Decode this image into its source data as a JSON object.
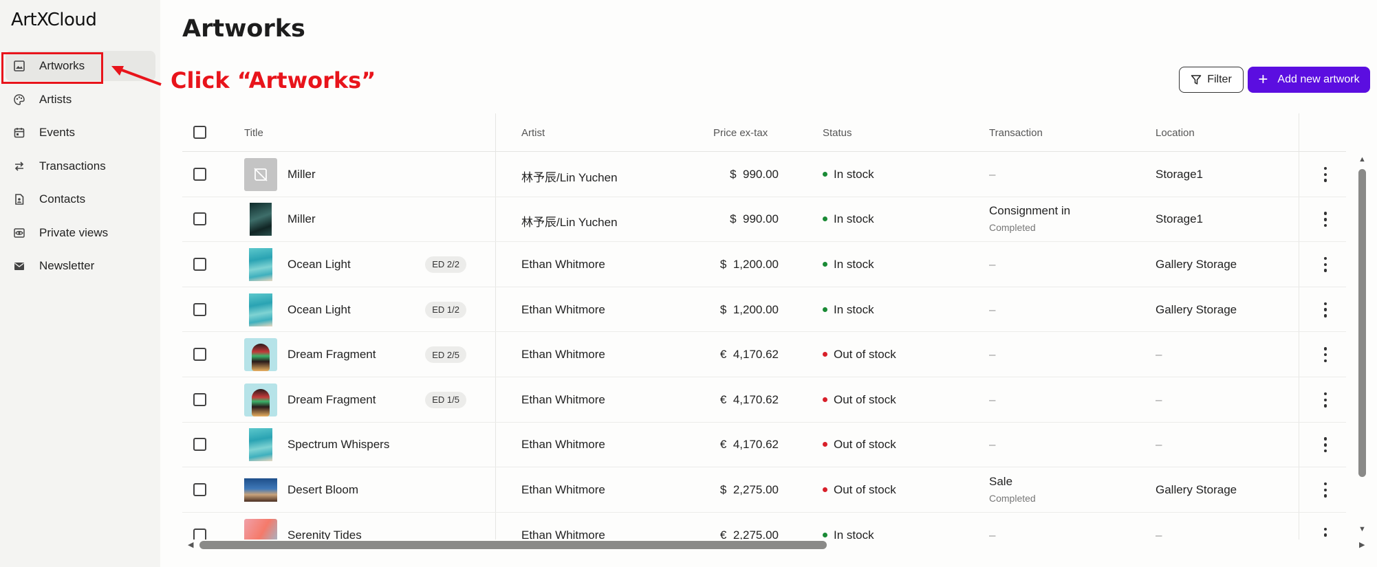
{
  "app": {
    "logo": "ArtXCloud"
  },
  "sidebar": {
    "items": [
      {
        "label": "Artworks",
        "icon": "image-icon",
        "active": true
      },
      {
        "label": "Artists",
        "icon": "palette-icon"
      },
      {
        "label": "Events",
        "icon": "calendar-icon"
      },
      {
        "label": "Transactions",
        "icon": "swap-icon"
      },
      {
        "label": "Contacts",
        "icon": "contact-icon"
      },
      {
        "label": "Private views",
        "icon": "eye-icon"
      },
      {
        "label": "Newsletter",
        "icon": "mail-icon"
      }
    ]
  },
  "annotation": {
    "text": "Click “Artworks”",
    "color": "#e8141b"
  },
  "page": {
    "title": "Artworks"
  },
  "toolbar": {
    "filter_label": "Filter",
    "add_label": "Add new artwork",
    "accent": "#5b0ee0"
  },
  "table": {
    "columns": [
      "Title",
      "Artist",
      "Price ex-tax",
      "Status",
      "Transaction",
      "Location"
    ],
    "rows": [
      {
        "title": "Miller",
        "edition": "",
        "artist": "林予辰/Lin Yuchen",
        "price": "$  990.00",
        "status": "In stock",
        "status_color": "#1a8a35",
        "transaction": "–",
        "transaction_sub": "",
        "location": "Storage1",
        "thumb": "placeholder"
      },
      {
        "title": "Miller",
        "edition": "",
        "artist": "林予辰/Lin Yuchen",
        "price": "$  990.00",
        "status": "In stock",
        "status_color": "#1a8a35",
        "transaction": "Consignment in",
        "transaction_sub": "Completed",
        "location": "Storage1",
        "thumb": "dark-green"
      },
      {
        "title": "Ocean Light",
        "edition": "ED 2/2",
        "artist": "Ethan Whitmore",
        "price": "$  1,200.00",
        "status": "In stock",
        "status_color": "#1a8a35",
        "transaction": "–",
        "transaction_sub": "",
        "location": "Gallery Storage",
        "thumb": "ocean"
      },
      {
        "title": "Ocean Light",
        "edition": "ED 1/2",
        "artist": "Ethan Whitmore",
        "price": "$  1,200.00",
        "status": "In stock",
        "status_color": "#1a8a35",
        "transaction": "–",
        "transaction_sub": "",
        "location": "Gallery Storage",
        "thumb": "ocean"
      },
      {
        "title": "Dream Fragment",
        "edition": "ED 2/5",
        "artist": "Ethan Whitmore",
        "price": "€  4,170.62",
        "status": "Out of stock",
        "status_color": "#d8202a",
        "transaction": "–",
        "transaction_sub": "",
        "location": "–",
        "thumb": "portrait"
      },
      {
        "title": "Dream Fragment",
        "edition": "ED 1/5",
        "artist": "Ethan Whitmore",
        "price": "€  4,170.62",
        "status": "Out of stock",
        "status_color": "#d8202a",
        "transaction": "–",
        "transaction_sub": "",
        "location": "–",
        "thumb": "portrait"
      },
      {
        "title": "Spectrum Whispers",
        "edition": "",
        "artist": "Ethan Whitmore",
        "price": "€  4,170.62",
        "status": "Out of stock",
        "status_color": "#d8202a",
        "transaction": "–",
        "transaction_sub": "",
        "location": "–",
        "thumb": "ocean"
      },
      {
        "title": "Desert Bloom",
        "edition": "",
        "artist": "Ethan Whitmore",
        "price": "$  2,275.00",
        "status": "Out of stock",
        "status_color": "#d8202a",
        "transaction": "Sale",
        "transaction_sub": "Completed",
        "location": "Gallery Storage",
        "thumb": "desert"
      },
      {
        "title": "Serenity Tides",
        "edition": "",
        "artist": "Ethan Whitmore",
        "price": "€  2,275.00",
        "status": "In stock",
        "status_color": "#1a8a35",
        "transaction": "–",
        "transaction_sub": "",
        "location": "–",
        "thumb": "pink"
      }
    ]
  }
}
